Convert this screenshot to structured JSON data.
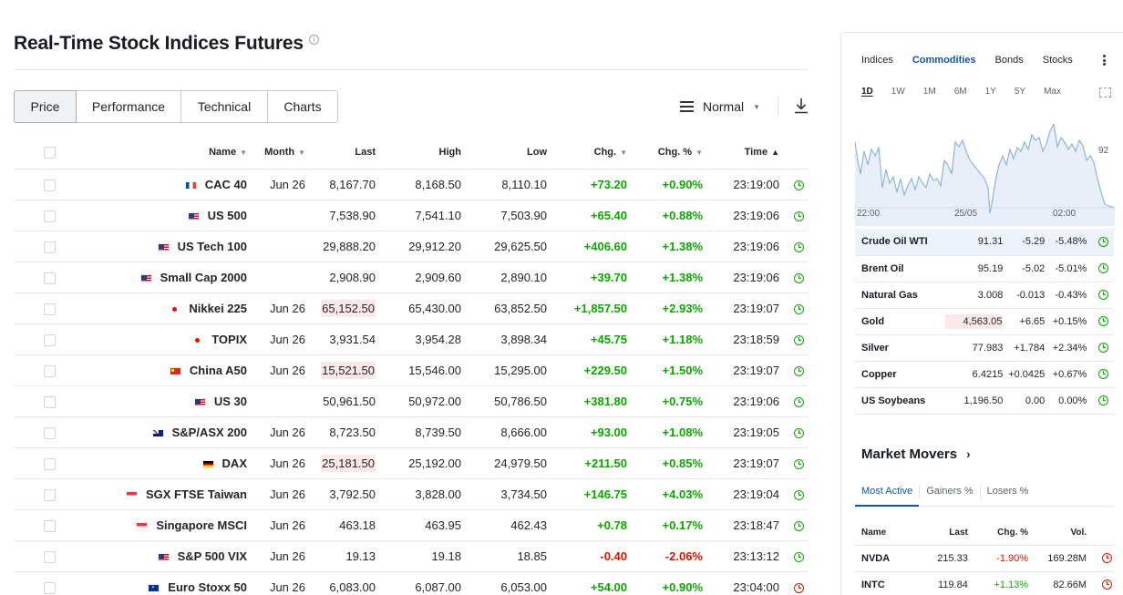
{
  "page": {
    "title": "Real-Time Stock Indices Futures",
    "info_glyph": "i"
  },
  "tabs": [
    {
      "label": "Price",
      "active": true
    },
    {
      "label": "Performance",
      "active": false
    },
    {
      "label": "Technical",
      "active": false
    },
    {
      "label": "Charts",
      "active": false
    }
  ],
  "view_select": {
    "value": "Normal"
  },
  "table": {
    "headers": {
      "name": "Name",
      "month": "Month",
      "last": "Last",
      "high": "High",
      "low": "Low",
      "chg": "Chg.",
      "chg_pct": "Chg. %",
      "time": "Time"
    },
    "rows": [
      {
        "flag": "fr",
        "name": "CAC 40",
        "month": "Jun 26",
        "last": "8,167.70",
        "last_hl": false,
        "high": "8,168.50",
        "low": "8,110.10",
        "chg": "+73.20",
        "chg_pct": "+0.90%",
        "dir": "pos",
        "time": "23:19:00",
        "clock": "green"
      },
      {
        "flag": "us",
        "name": "US 500",
        "month": "",
        "last": "7,538.90",
        "last_hl": false,
        "high": "7,541.10",
        "low": "7,503.90",
        "chg": "+65.40",
        "chg_pct": "+0.88%",
        "dir": "pos",
        "time": "23:19:06",
        "clock": "green"
      },
      {
        "flag": "us",
        "name": "US Tech 100",
        "month": "",
        "last": "29,888.20",
        "last_hl": false,
        "high": "29,912.20",
        "low": "29,625.50",
        "chg": "+406.60",
        "chg_pct": "+1.38%",
        "dir": "pos",
        "time": "23:19:06",
        "clock": "green"
      },
      {
        "flag": "us",
        "name": "Small Cap 2000",
        "month": "",
        "last": "2,908.90",
        "last_hl": false,
        "high": "2,909.60",
        "low": "2,890.10",
        "chg": "+39.70",
        "chg_pct": "+1.38%",
        "dir": "pos",
        "time": "23:19:06",
        "clock": "green"
      },
      {
        "flag": "jp",
        "name": "Nikkei 225",
        "month": "Jun 26",
        "last": "65,152.50",
        "last_hl": true,
        "high": "65,430.00",
        "low": "63,852.50",
        "chg": "+1,857.50",
        "chg_pct": "+2.93%",
        "dir": "pos",
        "time": "23:19:07",
        "clock": "green"
      },
      {
        "flag": "jp",
        "name": "TOPIX",
        "month": "Jun 26",
        "last": "3,931.54",
        "last_hl": false,
        "high": "3,954.28",
        "low": "3,898.34",
        "chg": "+45.75",
        "chg_pct": "+1.18%",
        "dir": "pos",
        "time": "23:18:59",
        "clock": "green"
      },
      {
        "flag": "cn",
        "name": "China A50",
        "month": "Jun 26",
        "last": "15,521.50",
        "last_hl": true,
        "high": "15,546.00",
        "low": "15,295.00",
        "chg": "+229.50",
        "chg_pct": "+1.50%",
        "dir": "pos",
        "time": "23:19:07",
        "clock": "green"
      },
      {
        "flag": "us",
        "name": "US 30",
        "month": "",
        "last": "50,961.50",
        "last_hl": false,
        "high": "50,972.00",
        "low": "50,786.50",
        "chg": "+381.80",
        "chg_pct": "+0.75%",
        "dir": "pos",
        "time": "23:19:06",
        "clock": "green"
      },
      {
        "flag": "au",
        "name": "S&P/ASX 200",
        "month": "Jun 26",
        "last": "8,723.50",
        "last_hl": false,
        "high": "8,739.50",
        "low": "8,666.00",
        "chg": "+93.00",
        "chg_pct": "+1.08%",
        "dir": "pos",
        "time": "23:19:05",
        "clock": "green"
      },
      {
        "flag": "de",
        "name": "DAX",
        "month": "Jun 26",
        "last": "25,181.50",
        "last_hl": true,
        "high": "25,192.00",
        "low": "24,979.50",
        "chg": "+211.50",
        "chg_pct": "+0.85%",
        "dir": "pos",
        "time": "23:19:07",
        "clock": "green"
      },
      {
        "flag": "sg",
        "name": "SGX FTSE Taiwan",
        "month": "Jun 26",
        "last": "3,792.50",
        "last_hl": false,
        "high": "3,828.00",
        "low": "3,734.50",
        "chg": "+146.75",
        "chg_pct": "+4.03%",
        "dir": "pos",
        "time": "23:19:04",
        "clock": "green"
      },
      {
        "flag": "sg",
        "name": "Singapore MSCI",
        "month": "Jun 26",
        "last": "463.18",
        "last_hl": false,
        "high": "463.95",
        "low": "462.43",
        "chg": "+0.78",
        "chg_pct": "+0.17%",
        "dir": "pos",
        "time": "23:18:47",
        "clock": "green"
      },
      {
        "flag": "us",
        "name": "S&P 500 VIX",
        "month": "Jun 26",
        "last": "19.13",
        "last_hl": false,
        "high": "19.18",
        "low": "18.85",
        "chg": "-0.40",
        "chg_pct": "-2.06%",
        "dir": "neg",
        "time": "23:13:12",
        "clock": "green"
      },
      {
        "flag": "eu",
        "name": "Euro Stoxx 50",
        "month": "Jun 26",
        "last": "6,083.00",
        "last_hl": false,
        "high": "6,087.00",
        "low": "6,053.00",
        "chg": "+54.00",
        "chg_pct": "+0.90%",
        "dir": "pos",
        "time": "23:04:00",
        "clock": "red"
      }
    ]
  },
  "right_panel": {
    "tabs": [
      {
        "label": "Indices",
        "active": false
      },
      {
        "label": "Commodities",
        "active": true
      },
      {
        "label": "Bonds",
        "active": false
      },
      {
        "label": "Stocks",
        "active": false
      }
    ],
    "ranges": [
      {
        "label": "1D",
        "active": true
      },
      {
        "label": "1W",
        "active": false
      },
      {
        "label": "1M",
        "active": false
      },
      {
        "label": "6M",
        "active": false
      },
      {
        "label": "1Y",
        "active": false
      },
      {
        "label": "5Y",
        "active": false
      },
      {
        "label": "Max",
        "active": false
      }
    ],
    "chart": {
      "x_ticks": [
        "22:00",
        "25/05",
        "02:00"
      ],
      "y_tick": "92",
      "line_color": "#8fb4dc",
      "fill_color": "#e8eff9"
    },
    "commodities": [
      {
        "name": "Crude Oil WTI",
        "last": "91.31",
        "chg": "-5.29",
        "pct": "-5.48%",
        "dir": "neg",
        "selected": true,
        "hl": false
      },
      {
        "name": "Brent Oil",
        "last": "95.19",
        "chg": "-5.02",
        "pct": "-5.01%",
        "dir": "neg",
        "selected": false,
        "hl": false
      },
      {
        "name": "Natural Gas",
        "last": "3.008",
        "chg": "-0.013",
        "pct": "-0.43%",
        "dir": "neg",
        "selected": false,
        "hl": false
      },
      {
        "name": "Gold",
        "last": "4,563.05",
        "chg": "+6.65",
        "pct": "+0.15%",
        "dir": "pos",
        "selected": false,
        "hl": true
      },
      {
        "name": "Silver",
        "last": "77.983",
        "chg": "+1.784",
        "pct": "+2.34%",
        "dir": "pos",
        "selected": false,
        "hl": false
      },
      {
        "name": "Copper",
        "last": "6.4215",
        "chg": "+0.0425",
        "pct": "+0.67%",
        "dir": "pos",
        "selected": false,
        "hl": false
      },
      {
        "name": "US Soybeans",
        "last": "1,196.50",
        "chg": "0.00",
        "pct": "0.00%",
        "dir": "neu",
        "selected": false,
        "hl": false
      }
    ],
    "market_movers": {
      "title": "Market Movers",
      "tabs": [
        {
          "label": "Most Active",
          "active": true
        },
        {
          "label": "Gainers %",
          "active": false
        },
        {
          "label": "Losers %",
          "active": false
        }
      ],
      "headers": {
        "name": "Name",
        "last": "Last",
        "chg_pct": "Chg. %",
        "vol": "Vol."
      },
      "rows": [
        {
          "name": "NVDA",
          "last": "215.33",
          "chg_pct": "-1.90%",
          "dir": "neg",
          "vol": "169.28M"
        },
        {
          "name": "INTC",
          "last": "119.84",
          "chg_pct": "+1.13%",
          "dir": "pos",
          "vol": "82.66M"
        }
      ]
    }
  }
}
